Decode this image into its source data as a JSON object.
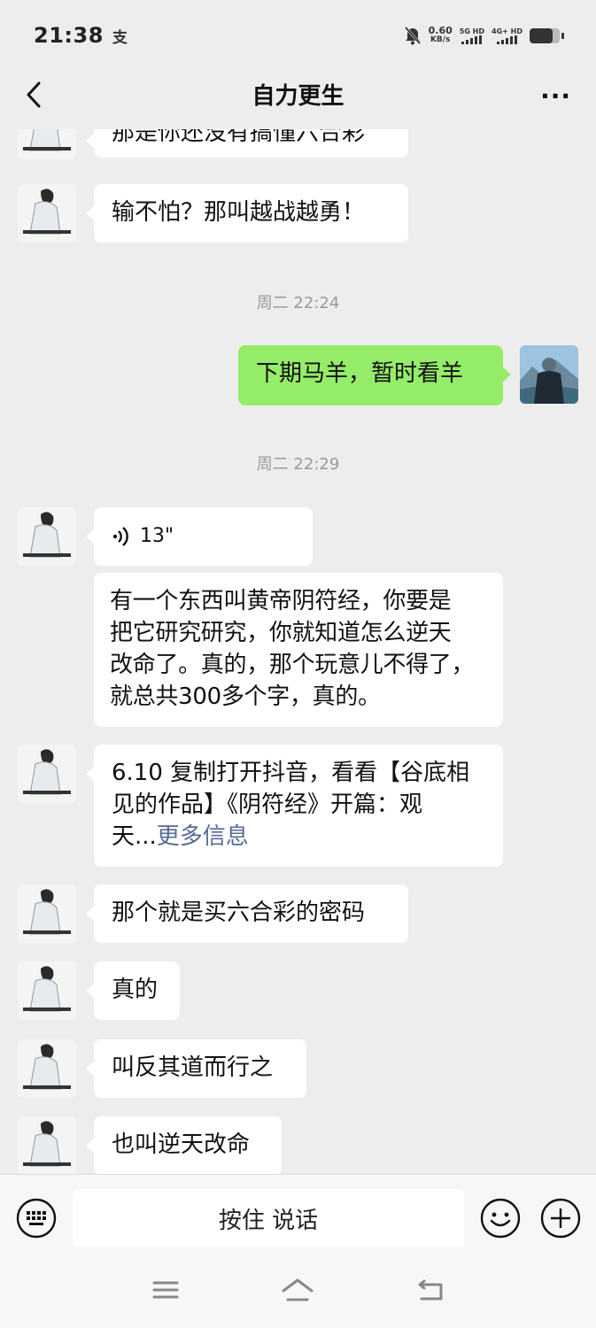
{
  "status_bar": {
    "time": "21:38",
    "speed_value": "0.60",
    "speed_unit": "KB/s",
    "sim1": "5G HD",
    "sim2": "4G+ HD",
    "battery_level": 0.75,
    "icons": [
      "alipay-icon",
      "mute-bell-icon",
      "signal-icon",
      "battery-icon"
    ]
  },
  "nav": {
    "title": "自力更生",
    "back_icon": "chevron-left-icon",
    "more_icon": "more-dots-icon",
    "more_label": "···"
  },
  "messages": [
    {
      "type": "text",
      "side": "left",
      "text": "那是你还没有搞懂六合彩"
    },
    {
      "type": "text",
      "side": "left",
      "text": "输不怕？那叫越战越勇！"
    },
    {
      "type": "time",
      "text": "周二 22:24"
    },
    {
      "type": "text",
      "side": "right",
      "text": "下期马羊，暂时看羊"
    },
    {
      "type": "time",
      "text": "周二 22:29"
    },
    {
      "type": "voice",
      "side": "left",
      "duration": "13\""
    },
    {
      "type": "text",
      "side": "left",
      "lines": [
        "有一个东西叫黄帝阴符经，你要是",
        "把它研究研究，你就知道怎么逆天",
        "改命了。真的，那个玩意儿不得了，",
        "就总共300多个字，真的。"
      ]
    },
    {
      "type": "share",
      "side": "left",
      "lines": [
        "6.10 复制打开抖音，看看【谷底相",
        "见的作品】《阴符经》开篇：观"
      ],
      "last_line": "天...",
      "more_link": "更多信息"
    },
    {
      "type": "text",
      "side": "left",
      "text": "那个就是买六合彩的密码"
    },
    {
      "type": "text",
      "side": "left",
      "text": "真的"
    },
    {
      "type": "text",
      "side": "left",
      "text": "叫反其道而行之"
    },
    {
      "type": "text",
      "side": "left",
      "text": "也叫逆天改命"
    }
  ],
  "input_bar": {
    "talk_label": "按住 说话",
    "icons": [
      "keyboard-icon",
      "emoji-icon",
      "plus-icon"
    ]
  },
  "system_nav": {
    "icons": [
      "menu-icon",
      "home-icon",
      "back-icon"
    ]
  }
}
